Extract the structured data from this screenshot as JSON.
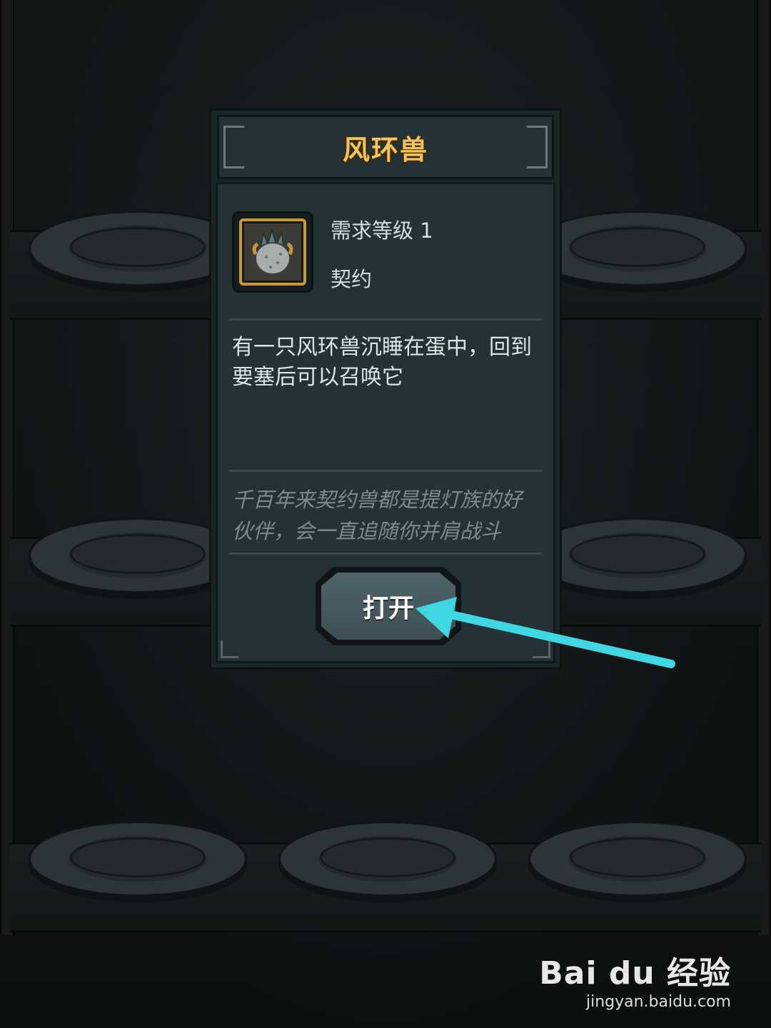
{
  "dialog": {
    "title": "风环兽",
    "level_requirement": "需求等级 1",
    "item_type": "契约",
    "description": "有一只风环兽沉睡在蛋中，回到要塞后可以召唤它",
    "flavor_text": "千百年来契约兽都是提灯族的好伙伴，会一直追随你并肩战斗",
    "open_button_label": "打开",
    "item_icon": "egg-creature-icon"
  },
  "annotation": {
    "arrow_icon": "pointer-arrow-icon",
    "arrow_color": "#3fd8e2"
  },
  "watermark": {
    "logo": "Bai du 经验",
    "url": "jingyan.baidu.com"
  },
  "colors": {
    "title": "#f2c45a",
    "panel": "#243236",
    "item_frame": "#c89a35",
    "flavor_text": "#7c8a8e"
  }
}
